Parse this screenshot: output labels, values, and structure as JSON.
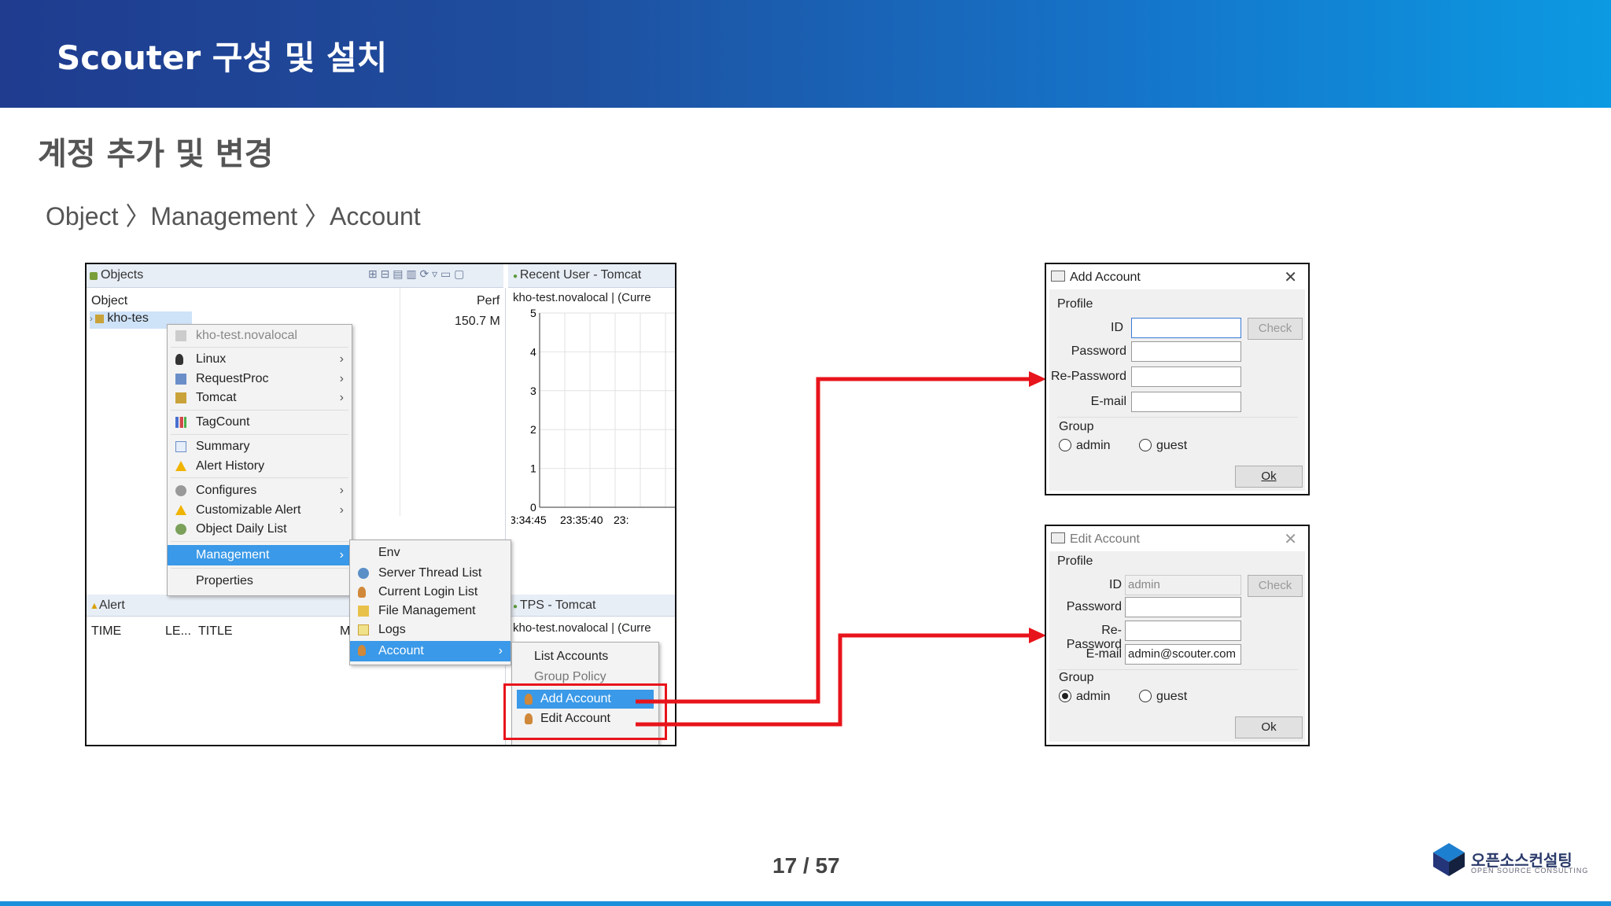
{
  "header": {
    "title": "Scouter 구성 및 설치"
  },
  "subtitle": "계정 추가 및 변경",
  "breadcrumb": "Object 〉Management 〉Account",
  "footer": {
    "page": "17 / 57",
    "logo_name": "오픈소스컨설팅",
    "logo_sub": "OPEN SOURCE CONSULTING"
  },
  "eclipse": {
    "objects_tab": "Objects",
    "col_object": "Object",
    "col_perf": "Perf",
    "tree_item": "kho-tes",
    "perf_value": "150.7 M",
    "recent_user_tab": "Recent User - Tomcat",
    "recent_user_sub": "kho-test.novalocal | (Curre",
    "y_ticks": [
      "5",
      "4",
      "3",
      "2",
      "1",
      "0"
    ],
    "x_ticks": [
      "3:34:45",
      "23:35:40",
      "23:"
    ],
    "tps_tab": "TPS - Tomcat",
    "tps_sub": "kho-test.novalocal | (Curre",
    "alert_tab": "Alert",
    "alert_cols": [
      "TIME",
      "LE...",
      "TITLE",
      "M"
    ],
    "context_menu": {
      "header": "kho-test.novalocal",
      "items": [
        "Linux",
        "RequestProc",
        "Tomcat",
        "TagCount",
        "Summary",
        "Alert History",
        "Configures",
        "Customizable Alert",
        "Object Daily List",
        "Management",
        "Properties"
      ]
    },
    "management_menu": [
      "Env",
      "Server Thread List",
      "Current Login List",
      "File Management",
      "Logs",
      "Account"
    ],
    "account_menu": [
      "List Accounts",
      "Group Policy",
      "Add Account",
      "Edit Account"
    ]
  },
  "add_dialog": {
    "title": "Add Account",
    "profile": "Profile",
    "id_label": "ID",
    "id_value": "",
    "check": "Check",
    "password": "Password",
    "repassword": "Re-Password",
    "email": "E-mail",
    "email_value": "",
    "group": "Group",
    "admin": "admin",
    "guest": "guest",
    "ok": "Ok"
  },
  "edit_dialog": {
    "title": "Edit Account",
    "profile": "Profile",
    "id_label": "ID",
    "id_value": "admin",
    "check": "Check",
    "password": "Password",
    "repassword": "Re-Password",
    "email": "E-mail",
    "email_value": "admin@scouter.com",
    "group": "Group",
    "admin": "admin",
    "guest": "guest",
    "ok": "Ok"
  },
  "colors": {
    "arrow": "#e8141b",
    "menu_selected": "#3a99e8",
    "header_start": "#1f3c8f",
    "header_end": "#0c9ae2"
  }
}
